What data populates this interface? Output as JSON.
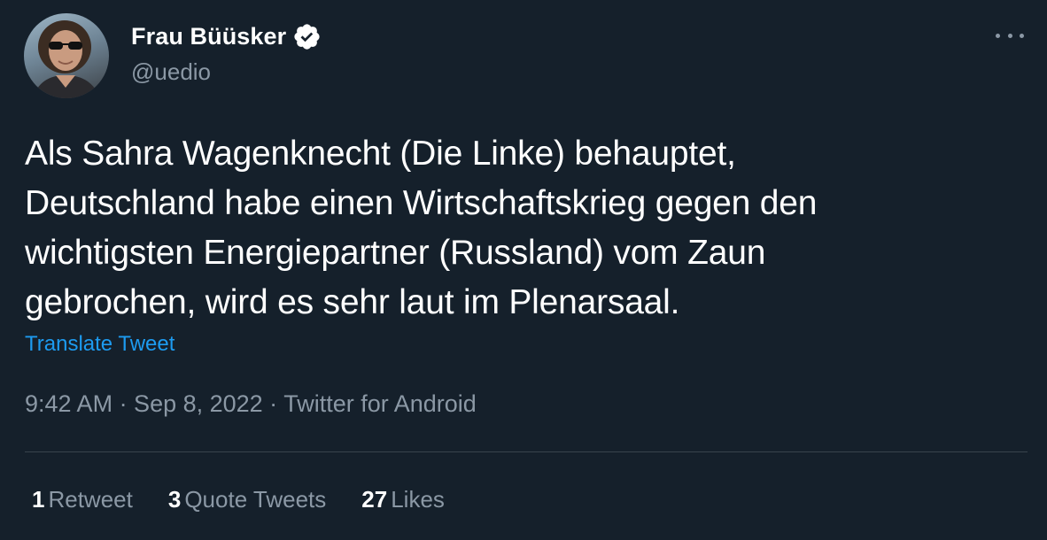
{
  "author": {
    "display_name": "Frau Büüsker",
    "handle": "@uedio",
    "verified_icon": "verified-badge-icon",
    "avatar": "profile-photo"
  },
  "tweet": {
    "text": "Als Sahra Wagenknecht (Die Linke) behauptet,\nDeutschland habe einen Wirtschaftskrieg gegen den\nwichtigsten Energiepartner (Russland) vom Zaun\ngebrochen, wird es sehr laut im Plenarsaal.",
    "translate_label": "Translate Tweet",
    "meta": "9:42 AM · Sep 8, 2022 · Twitter for Android"
  },
  "stats": {
    "retweets_count": "1",
    "retweets_label": "Retweet",
    "quotes_count": "3",
    "quotes_label": "Quote Tweets",
    "likes_count": "27",
    "likes_label": "Likes"
  },
  "colors": {
    "background": "#15202b",
    "secondary_text": "#8b98a5",
    "link": "#1d9bf0",
    "divider": "#38444d"
  }
}
